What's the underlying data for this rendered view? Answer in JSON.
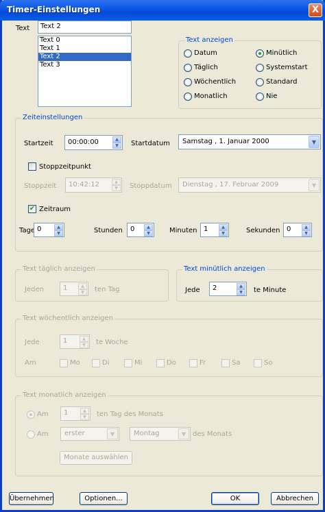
{
  "window": {
    "title": "Timer-Einstellungen",
    "close_glyph": "X"
  },
  "text_section": {
    "label": "Text",
    "input_value": "Text 2",
    "list_items": [
      "Text 0",
      "Text 1",
      "Text 2",
      "Text 3"
    ],
    "selected_item": "Text 2"
  },
  "text_anzeigen": {
    "title": "Text anzeigen",
    "options": [
      {
        "label": "Datum",
        "checked": false
      },
      {
        "label": "Minütlich",
        "checked": true
      },
      {
        "label": "Täglich",
        "checked": false
      },
      {
        "label": "Systemstart",
        "checked": false
      },
      {
        "label": "Wöchentlich",
        "checked": false
      },
      {
        "label": "Standard",
        "checked": false
      },
      {
        "label": "Monatlich",
        "checked": false
      },
      {
        "label": "Nie",
        "checked": false
      }
    ]
  },
  "zeiteinstellungen": {
    "title": "Zeiteinstellungen",
    "startzeit_label": "Startzeit",
    "startzeit_value": "00:00:00",
    "startdatum_label": "Startdatum",
    "startdatum_value": "Samstag  ,  1.   Januar   2000",
    "stoppzeitpunkt_label": "Stoppzeitpunkt",
    "stoppzeitpunkt_checked": false,
    "stoppzeit_label": "Stoppzeit",
    "stoppzeit_value": "10:42:12",
    "stoppdatum_label": "Stoppdatum",
    "stoppdatum_value": "Dienstag , 17.  Februar  2009",
    "zeitraum_label": "Zeitraum",
    "zeitraum_checked": true,
    "tage_label": "Tage",
    "tage_value": "0",
    "stunden_label": "Stunden",
    "stunden_value": "0",
    "minuten_label": "Minuten",
    "minuten_value": "1",
    "sekunden_label": "Sekunden",
    "sekunden_value": "0"
  },
  "taeglich": {
    "title": "Text täglich anzeigen",
    "prefix": "Jeden",
    "value": "1",
    "suffix": "ten Tag"
  },
  "minuetlich": {
    "title": "Text minütlich anzeigen",
    "prefix": "Jede",
    "value": "2",
    "suffix": "te Minute"
  },
  "woechentlich": {
    "title": "Text wöchentlich anzeigen",
    "prefix": "Jede",
    "value": "1",
    "suffix": "te Woche",
    "am_label": "Am",
    "days": [
      "Mo",
      "Di",
      "Mi",
      "Do",
      "Fr",
      "Sa",
      "So"
    ]
  },
  "monatlich": {
    "title": "Text monatlich anzeigen",
    "am1_label": "Am",
    "am1_value": "1",
    "am1_suffix": "ten Tag des Monats",
    "am2_label": "Am",
    "ordinal_value": "erster",
    "weekday_value": "Montag",
    "am2_suffix": "des Monats",
    "months_button": "Monate auswählen"
  },
  "footer": {
    "apply": "Übernehmen",
    "options": "Optionen...",
    "ok": "OK",
    "cancel": "Abbrechen"
  },
  "icons": {
    "spin_up": "▲",
    "spin_down": "▼",
    "dropdown": "▼",
    "check": "✔"
  },
  "colors": {
    "title_bar": "#0955e3",
    "group_title": "#0046d5",
    "selection": "#316ac5",
    "dialog_bg": "#ece9d8"
  }
}
